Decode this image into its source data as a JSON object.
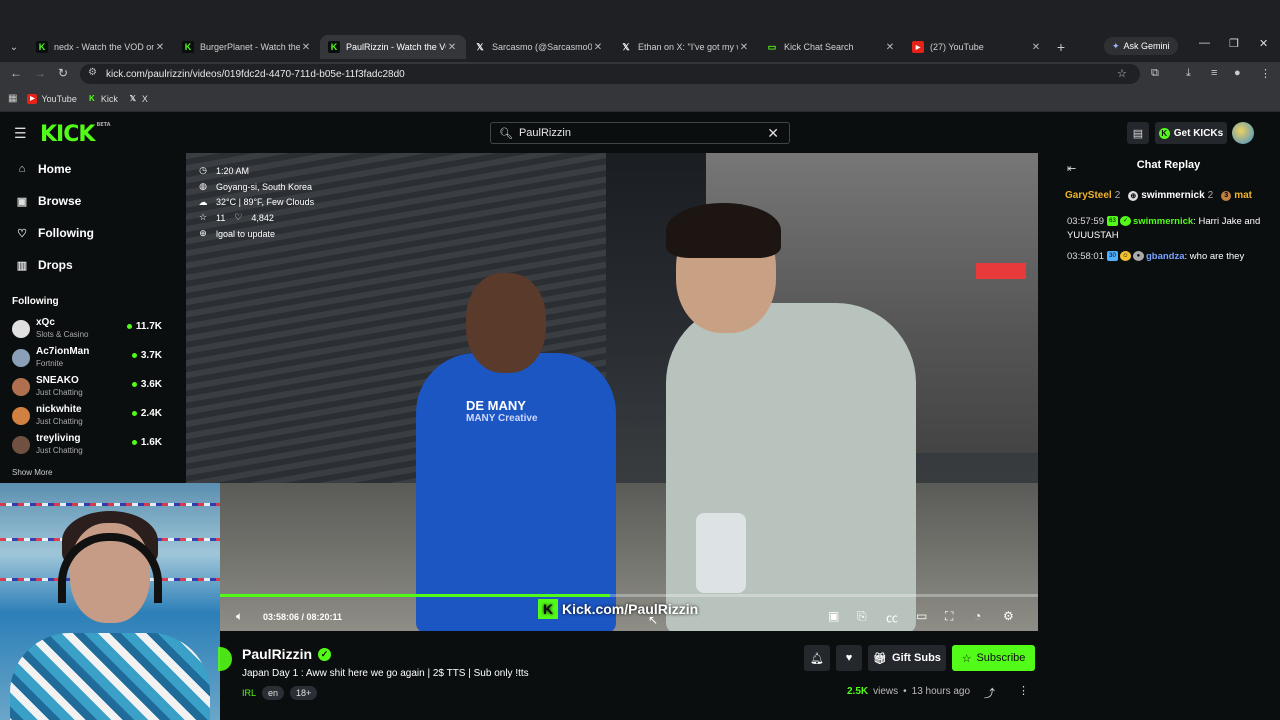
{
  "browser": {
    "tabs": [
      {
        "title": "nedx - Watch the VOD on K",
        "favicon": "kick",
        "active": false
      },
      {
        "title": "BurgerPlanet - Watch the V",
        "favicon": "kick",
        "active": false
      },
      {
        "title": "PaulRizzin - Watch the VOD",
        "favicon": "kick",
        "active": true
      },
      {
        "title": "Sarcasmo (@Sarcasmo0110",
        "favicon": "x",
        "active": false
      },
      {
        "title": "Ethan on X: \"I've got my wa",
        "favicon": "x",
        "active": false
      },
      {
        "title": "Kick Chat Search",
        "favicon": "kickchat",
        "active": false
      },
      {
        "title": "(27) YouTube",
        "favicon": "youtube",
        "active": false
      }
    ],
    "new_tab": "+",
    "gemini_label": "Ask Gemini",
    "url": "kick.com/paulrizzin/videos/019fdc2d-4470-711d-b05e-11f3fadc28d0",
    "bookmarks": [
      {
        "label": "YouTube",
        "favicon": "youtube"
      },
      {
        "label": "Kick",
        "favicon": "kick"
      },
      {
        "label": "X",
        "favicon": "x"
      }
    ]
  },
  "header": {
    "logo": "KICK",
    "logo_badge": "BETA",
    "search_value": "PaulRizzin",
    "get_kicks": "Get KICKs"
  },
  "sidebar": {
    "nav": [
      {
        "label": "Home",
        "icon": "home-icon"
      },
      {
        "label": "Browse",
        "icon": "browse-icon"
      },
      {
        "label": "Following",
        "icon": "heart-icon"
      },
      {
        "label": "Drops",
        "icon": "drops-icon"
      }
    ],
    "following_heading": "Following",
    "following": [
      {
        "name": "xQc",
        "category": "Slots & Casino",
        "viewers": "11.7K",
        "color": "#e0e0e0"
      },
      {
        "name": "Ac7ionMan",
        "category": "Fortnite",
        "viewers": "3.7K",
        "color": "#8aa0b8"
      },
      {
        "name": "SNEAKO",
        "category": "Just Chatting",
        "viewers": "3.6K",
        "color": "#b07050"
      },
      {
        "name": "nickwhite",
        "category": "Just Chatting",
        "viewers": "2.4K",
        "color": "#d08040"
      },
      {
        "name": "treyliving",
        "category": "Just Chatting",
        "viewers": "1.6K",
        "color": "#705040"
      }
    ],
    "show_more": "Show More"
  },
  "video": {
    "overlay": {
      "time": "1:20 AM",
      "location": "Goyang-si, South Korea",
      "weather": "32°C | 89°F, Few Clouds",
      "stars": "11",
      "likes": "4,842",
      "goal": "lgoal to update"
    },
    "shirt_text_line1": "DE MANY",
    "shirt_text_line2": "MANY Creative",
    "timecode": "03:58:06 / 08:20:11",
    "progress": 0.477,
    "watermark": "Kick.com/PaulRizzin",
    "accent": "#53fc18"
  },
  "channel": {
    "name": "PaulRizzin",
    "title": "Japan Day 1 : Aww shit here we go again | 2$ TTS | Sub only !tts",
    "category": "IRL",
    "tags": [
      "en",
      "18+"
    ],
    "gift_subs": "Gift Subs",
    "subscribe": "Subscribe",
    "views": "2.5K",
    "views_suffix": "views",
    "separator": "•",
    "age": "13 hours ago"
  },
  "chat": {
    "heading": "Chat Replay",
    "gifters": [
      {
        "name": "GarySteel",
        "rank": "2",
        "color": "#f0b429"
      },
      {
        "name": "swimmernick",
        "rank": "2",
        "color": "#ffffff"
      },
      {
        "name": "mat",
        "rank": "",
        "color": "#f0b429"
      }
    ],
    "messages": [
      {
        "time": "03:57:59",
        "user": "swimmernick",
        "user_color": "#53fc18",
        "badges": [
          "63",
          "✓"
        ],
        "text": "Harri Jake and YUUUSTAH"
      },
      {
        "time": "03:58:01",
        "user": "gbandza",
        "user_color": "#7aa2ff",
        "badges": [
          "30",
          "☺",
          "●"
        ],
        "text": "who are they"
      }
    ]
  }
}
